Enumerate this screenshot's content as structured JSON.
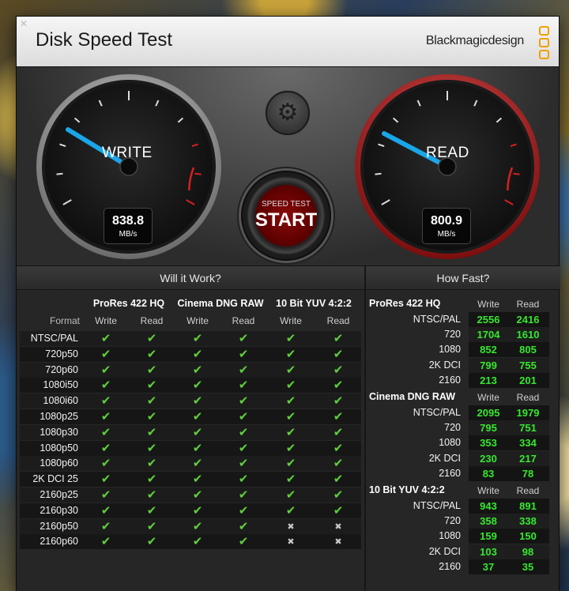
{
  "window": {
    "title": "Disk Speed Test",
    "brand": "Blackmagicdesign",
    "close_icon": "close-icon",
    "colors": {
      "accent_red": "#d62020",
      "needle_blue": "#1aa6e8",
      "value_green": "#36e82e",
      "check_green": "#5fcf3c",
      "brand_orange": "#f0a000"
    }
  },
  "gauges": {
    "write": {
      "label": "WRITE",
      "value": "838.8",
      "unit": "MB/s"
    },
    "read": {
      "label": "READ",
      "value": "800.9",
      "unit": "MB/s"
    }
  },
  "controls": {
    "settings_icon": "gear-icon",
    "start_small": "SPEED TEST",
    "start_big": "START"
  },
  "will_it_work": {
    "title": "Will it Work?",
    "groups": [
      "ProRes 422 HQ",
      "Cinema DNG RAW",
      "10 Bit YUV 4:2:2"
    ],
    "format_label": "Format",
    "write_label": "Write",
    "read_label": "Read",
    "rows": [
      {
        "format": "NTSC/PAL",
        "cells": [
          true,
          true,
          true,
          true,
          true,
          true
        ]
      },
      {
        "format": "720p50",
        "cells": [
          true,
          true,
          true,
          true,
          true,
          true
        ]
      },
      {
        "format": "720p60",
        "cells": [
          true,
          true,
          true,
          true,
          true,
          true
        ]
      },
      {
        "format": "1080i50",
        "cells": [
          true,
          true,
          true,
          true,
          true,
          true
        ]
      },
      {
        "format": "1080i60",
        "cells": [
          true,
          true,
          true,
          true,
          true,
          true
        ]
      },
      {
        "format": "1080p25",
        "cells": [
          true,
          true,
          true,
          true,
          true,
          true
        ]
      },
      {
        "format": "1080p30",
        "cells": [
          true,
          true,
          true,
          true,
          true,
          true
        ]
      },
      {
        "format": "1080p50",
        "cells": [
          true,
          true,
          true,
          true,
          true,
          true
        ]
      },
      {
        "format": "1080p60",
        "cells": [
          true,
          true,
          true,
          true,
          true,
          true
        ]
      },
      {
        "format": "2K DCI 25",
        "cells": [
          true,
          true,
          true,
          true,
          true,
          true
        ]
      },
      {
        "format": "2160p25",
        "cells": [
          true,
          true,
          true,
          true,
          true,
          true
        ]
      },
      {
        "format": "2160p30",
        "cells": [
          true,
          true,
          true,
          true,
          true,
          true
        ]
      },
      {
        "format": "2160p50",
        "cells": [
          true,
          true,
          true,
          true,
          false,
          false
        ]
      },
      {
        "format": "2160p60",
        "cells": [
          true,
          true,
          true,
          true,
          false,
          false
        ]
      }
    ]
  },
  "how_fast": {
    "title": "How Fast?",
    "write_label": "Write",
    "read_label": "Read",
    "groups": [
      {
        "name": "ProRes 422 HQ",
        "rows": [
          {
            "label": "NTSC/PAL",
            "write": "2556",
            "read": "2416"
          },
          {
            "label": "720",
            "write": "1704",
            "read": "1610"
          },
          {
            "label": "1080",
            "write": "852",
            "read": "805"
          },
          {
            "label": "2K DCI",
            "write": "799",
            "read": "755"
          },
          {
            "label": "2160",
            "write": "213",
            "read": "201"
          }
        ]
      },
      {
        "name": "Cinema DNG RAW",
        "rows": [
          {
            "label": "NTSC/PAL",
            "write": "2095",
            "read": "1979"
          },
          {
            "label": "720",
            "write": "795",
            "read": "751"
          },
          {
            "label": "1080",
            "write": "353",
            "read": "334"
          },
          {
            "label": "2K DCI",
            "write": "230",
            "read": "217"
          },
          {
            "label": "2160",
            "write": "83",
            "read": "78"
          }
        ]
      },
      {
        "name": "10 Bit YUV 4:2:2",
        "rows": [
          {
            "label": "NTSC/PAL",
            "write": "943",
            "read": "891"
          },
          {
            "label": "720",
            "write": "358",
            "read": "338"
          },
          {
            "label": "1080",
            "write": "159",
            "read": "150"
          },
          {
            "label": "2K DCI",
            "write": "103",
            "read": "98"
          },
          {
            "label": "2160",
            "write": "37",
            "read": "35"
          }
        ]
      }
    ]
  }
}
